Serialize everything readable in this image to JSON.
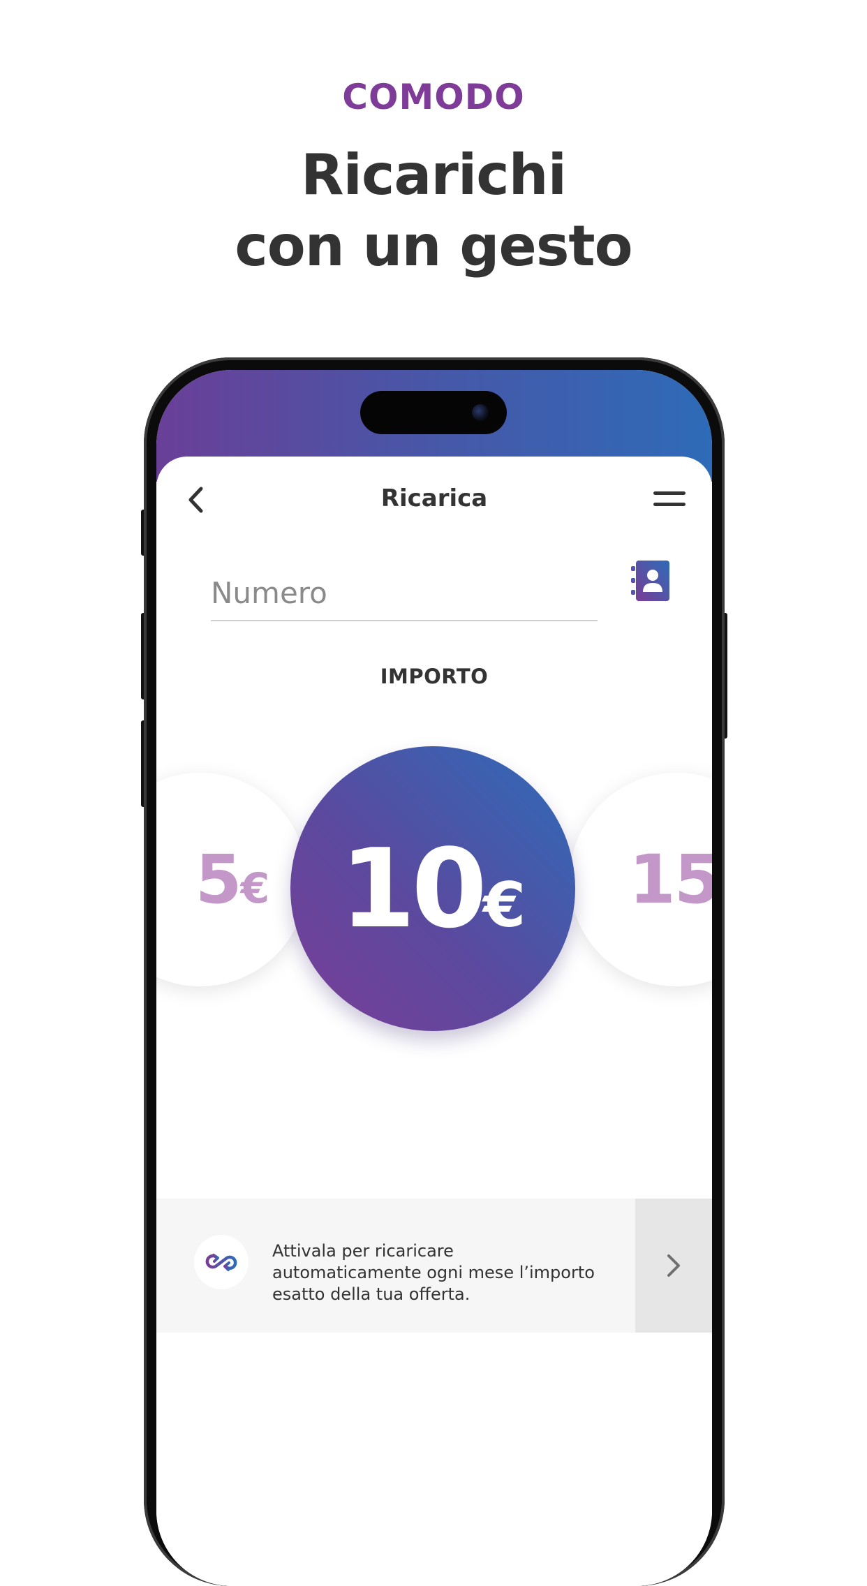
{
  "header": {
    "eyebrow": "COMODO",
    "headline_line1": "Ricarichi",
    "headline_line2": "con un gesto"
  },
  "app": {
    "title": "Ricarica",
    "back_icon": "chevron-left-icon",
    "menu_icon": "hamburger-menu-icon",
    "number_field": {
      "placeholder": "Numero",
      "value": ""
    },
    "contacts_icon": "address-book-icon",
    "amount_label": "IMPORTO",
    "amounts": [
      {
        "value": "5",
        "currency": "€",
        "selected": false
      },
      {
        "value": "10",
        "currency": "€",
        "selected": true
      },
      {
        "value": "15",
        "currency": "€",
        "selected": false
      }
    ],
    "auto_recharge": {
      "icon": "auto-recharge-icon",
      "text": "Attivala per ricaricare automaticamente ogni mese l’importo esatto della tua offerta.",
      "action_icon": "chevron-right-icon"
    }
  },
  "colors": {
    "accent": "#7e3b98",
    "gradient_start": "#7a3d96",
    "gradient_end": "#2d6cb8",
    "unselected_amount": "#c397c8",
    "text": "#333333"
  }
}
